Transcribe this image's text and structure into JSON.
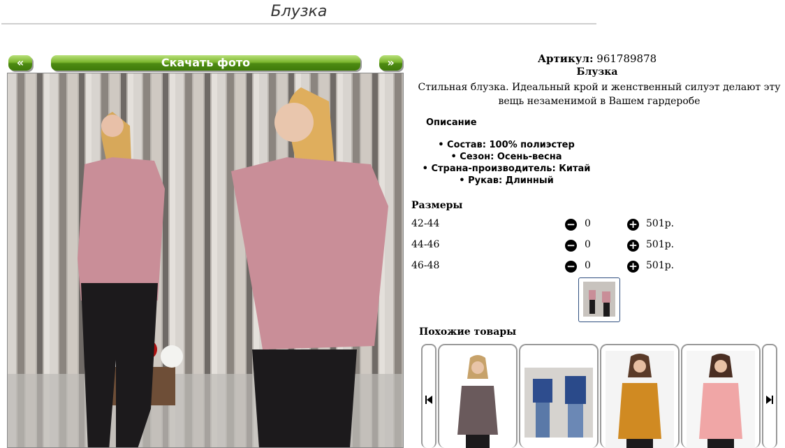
{
  "page_title": "Блузка",
  "gallery": {
    "prev_label": "«",
    "next_label": "»",
    "download_label": "Скачать фото"
  },
  "product": {
    "article_label": "Артикул:",
    "article_value": "961789878",
    "name": "Блузка",
    "description": "Стильная блузка. Идеальный крой и женственный силуэт делают эту вещь незаменимой в Вашем гардеробе",
    "description_heading": "Описание",
    "properties": [
      "Состав: 100% полиэстер",
      "Сезон: Осень-весна",
      "Страна-производитель: Китай",
      "Рукав: Длинный"
    ]
  },
  "sizes": {
    "heading": "Размеры",
    "rows": [
      {
        "size": "42-44",
        "qty": "0",
        "price": "501р."
      },
      {
        "size": "44-46",
        "qty": "0",
        "price": "501р."
      },
      {
        "size": "46-48",
        "qty": "0",
        "price": "501р."
      }
    ]
  },
  "similar": {
    "heading": "Похожие товары"
  },
  "colors": {
    "button_green": "#5a9a1a",
    "blouse_pink": "#c98e98",
    "thumb_border": "#2f4f7f"
  }
}
